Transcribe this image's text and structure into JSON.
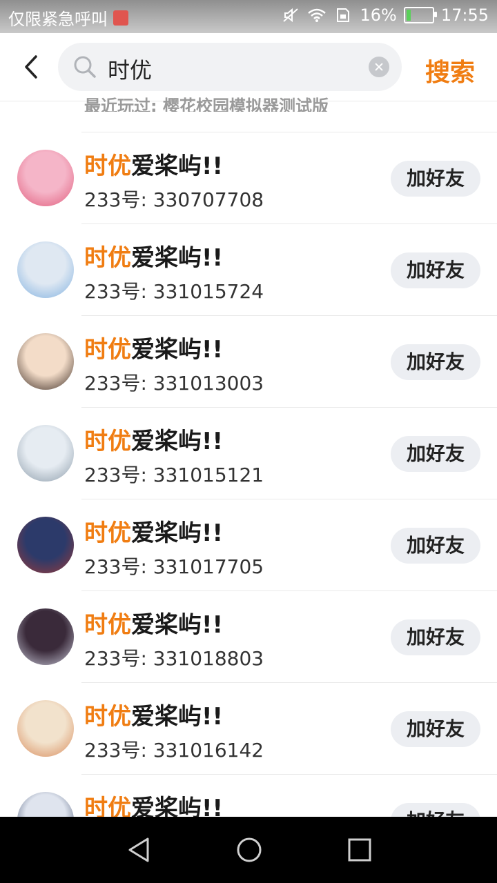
{
  "status_bar": {
    "carrier_text": "仅限紧急呼叫",
    "battery_percent": "16%",
    "time": "17:55"
  },
  "search": {
    "query": "时优",
    "submit_label": "搜索",
    "recent_text": "最近玩过: 樱花校园模拟器测试版"
  },
  "results": [
    {
      "name_highlight": "时优",
      "name_rest": "爱桨屿!!",
      "uid": "233号: 330707708",
      "add_label": "加好友",
      "avatar_colors": [
        "#f5b5c8",
        "#e05a7a"
      ]
    },
    {
      "name_highlight": "时优",
      "name_rest": "爱桨屿!!",
      "uid": "233号: 331015724",
      "add_label": "加好友",
      "avatar_colors": [
        "#dfe8f2",
        "#7fb0e0"
      ]
    },
    {
      "name_highlight": "时优",
      "name_rest": "爱桨屿!!",
      "uid": "233号: 331013003",
      "add_label": "加好友",
      "avatar_colors": [
        "#f3dcc8",
        "#3a2a22"
      ]
    },
    {
      "name_highlight": "时优",
      "name_rest": "爱桨屿!!",
      "uid": "233号: 331015121",
      "add_label": "加好友",
      "avatar_colors": [
        "#e6ecf2",
        "#8a9aa8"
      ]
    },
    {
      "name_highlight": "时优",
      "name_rest": "爱桨屿!!",
      "uid": "233号: 331017705",
      "add_label": "加好友",
      "avatar_colors": [
        "#2c3a6a",
        "#9a3a3a"
      ]
    },
    {
      "name_highlight": "时优",
      "name_rest": "爱桨屿!!",
      "uid": "233号: 331018803",
      "add_label": "加好友",
      "avatar_colors": [
        "#3a2a3a",
        "#c8c8d8"
      ]
    },
    {
      "name_highlight": "时优",
      "name_rest": "爱桨屿!!",
      "uid": "233号: 331016142",
      "add_label": "加好友",
      "avatar_colors": [
        "#f2e2cc",
        "#d88a5a"
      ]
    },
    {
      "name_highlight": "时优",
      "name_rest": "爱桨屿!!",
      "uid": "",
      "add_label": "加好友",
      "avatar_colors": [
        "#dfe4ee",
        "#2a3a5a"
      ]
    }
  ]
}
